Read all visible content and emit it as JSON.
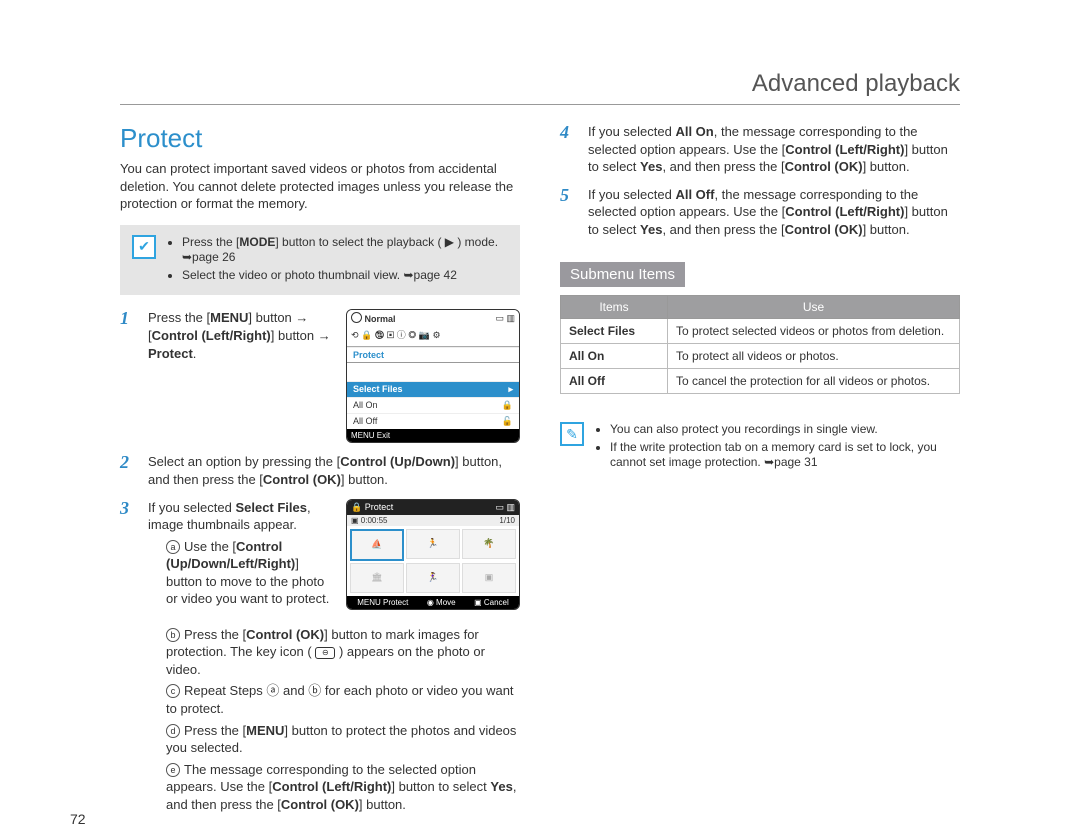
{
  "header": "Advanced playback",
  "page_number": "72",
  "section_title": "Protect",
  "intro": "You can protect important saved videos or photos from accidental deletion. You cannot delete protected images unless you release the protection or format the memory.",
  "note": {
    "lines": [
      {
        "pre": "Press the [",
        "bold": "MODE",
        "post": "] button to select the playback ( ▶ ) mode. ➥page 26"
      },
      {
        "pre": "Select the video or photo thumbnail view. ➥page 42",
        "bold": "",
        "post": ""
      }
    ]
  },
  "steps": [
    {
      "num": "1",
      "html": "Press the [<b>MENU</b>] button → [<b>Control (Left/Right)</b>] button → <b>Protect</b>."
    },
    {
      "num": "2",
      "html": "Select an option by pressing the [<b>Control (Up/Down)</b>] button, and then press the [<b>Control (OK)</b>] button."
    },
    {
      "num": "3",
      "html": "If you selected <b>Select Files</b>, image thumbnails appear.",
      "sub": [
        {
          "label": "a",
          "html": "Use the [<b>Control (Up/Down/Left/Right)</b>] button to move to the photo or video you want to protect."
        },
        {
          "label": "b",
          "html": "Press the [<b>Control (OK)</b>] button to mark images for protection. The key icon ( <span class=\"key-icon\">⊖</span> ) appears on the photo or video."
        },
        {
          "label": "c",
          "html": "Repeat Steps ⓐ and ⓑ for each photo or video you want to protect."
        },
        {
          "label": "d",
          "html": "Press the [<b>MENU</b>] button to protect the photos and videos you selected."
        },
        {
          "label": "e",
          "html": "The message corresponding to the selected option appears. Use the [<b>Control (Left/Right)</b>] button to select <b>Yes</b>, and then press the [<b>Control (OK)</b>] button."
        }
      ]
    },
    {
      "num": "4",
      "html": "If you selected <b>All On</b>, the message corresponding to the selected option appears. Use the [<b>Control (Left/Right)</b>] button to select <b>Yes</b>, and then press the [<b>Control (OK)</b>] button."
    },
    {
      "num": "5",
      "html": "If you selected <b>All Off</b>, the message corresponding to the selected option appears. Use the [<b>Control (Left/Right)</b>] button to select <b>Yes</b>, and then press the [<b>Control (OK)</b>] button."
    }
  ],
  "submenu_heading": "Submenu Items",
  "table": {
    "headers": [
      "Items",
      "Use"
    ],
    "rows": [
      [
        "Select Files",
        "To protect selected videos or photos from deletion."
      ],
      [
        "All On",
        "To protect all videos or photos."
      ],
      [
        "All Off",
        "To cancel the protection for all videos or photos."
      ]
    ]
  },
  "tips": [
    "You can also protect you recordings in single view.",
    "If the write protection tab on a memory card is set to lock, you cannot set image protection. ➥page 31"
  ],
  "screenshot1": {
    "top_left": "Normal",
    "menu_title": "Protect",
    "items": [
      "Select Files",
      "All On",
      "All Off"
    ],
    "exit": "MENU  Exit"
  },
  "screenshot2": {
    "title": "Protect",
    "time": "0:00:55",
    "counter": "1/10",
    "footer": [
      "MENU Protect",
      "◉ Move",
      "▣ Cancel"
    ]
  }
}
